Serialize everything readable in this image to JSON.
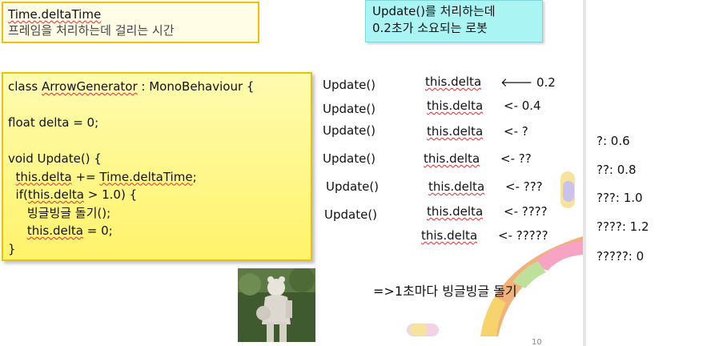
{
  "time_box": {
    "line1": "Time.deltaTime",
    "line2": "프레임을 처리하는데 걸리는 시간"
  },
  "robot_box": {
    "line1": "Update()를 처리하는데",
    "line2": "0.2초가 소요되는 로봇"
  },
  "code": {
    "l1a": "class ",
    "l1b": "ArrowGenerator",
    "l1c": " : MonoBehaviour {",
    "l2": "float delta = 0;",
    "l3": "void Update() {",
    "l4a": "  ",
    "l4b": "this.delta",
    "l4c": " += ",
    "l4d": "Time.deltaTime",
    "l4e": ";",
    "l5a": "  if(",
    "l5b": "this.delta",
    "l5c": " > 1.0) {",
    "l6": "     빙글빙글 돌기();",
    "l7a": "     ",
    "l7b": "this.delta",
    "l7c": " = 0;",
    "l8": "}"
  },
  "updates": [
    {
      "call": "Update()",
      "var": "this.delta",
      "value": "🡐 0.2"
    },
    {
      "call": "Update()",
      "var": "this.delta",
      "value": "<- 0.4"
    },
    {
      "call": "Update()",
      "var": "this.delta",
      "value": "<- ?"
    },
    {
      "call": "Update()",
      "var": "this.delta",
      "value": "<- ??"
    },
    {
      "call": "Update()",
      "var": "this.delta",
      "value": "<- ???"
    },
    {
      "call": "Update()",
      "var": "this.delta",
      "value": "<- ????"
    },
    {
      "call": "",
      "var": "this.delta",
      "value": "<- ?????"
    }
  ],
  "answers": [
    "?: 0.6",
    "??: 0.8",
    "???: 1.0",
    "????: 1.2",
    "?????: 0"
  ],
  "result": "=>1초마다 빙글빙글 돌기",
  "page_number": "10",
  "colors": {
    "code_bg": "#fff36a",
    "robot_bg": "#aaf4f4",
    "time_bg": "#fffde6",
    "border_gold": "#e8c300"
  }
}
